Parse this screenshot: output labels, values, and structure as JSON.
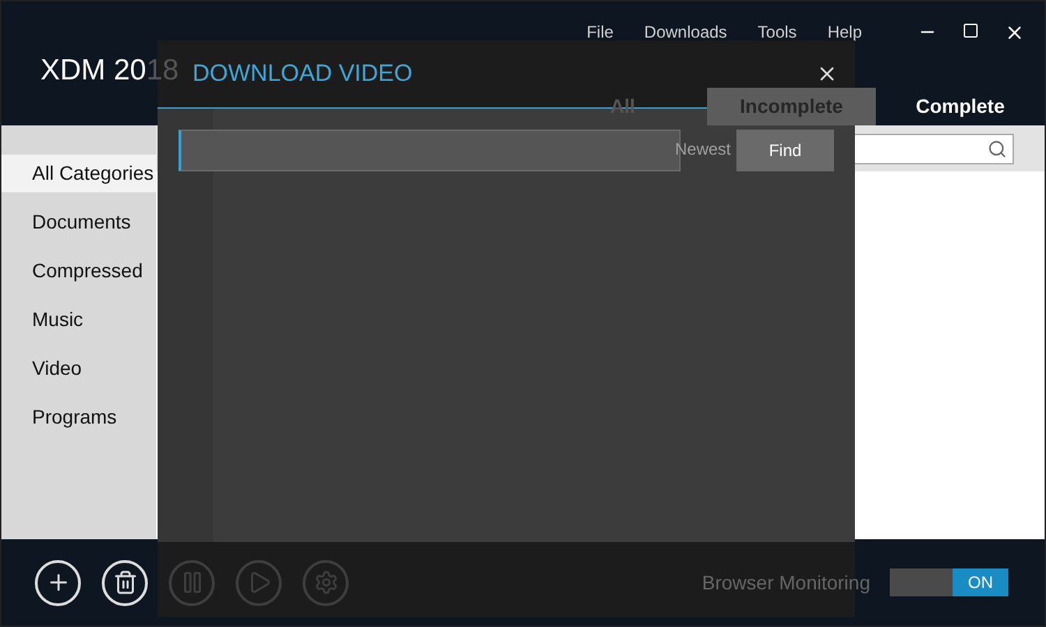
{
  "window": {
    "title": "XDM 2018",
    "menu": [
      "File",
      "Downloads",
      "Tools",
      "Help"
    ]
  },
  "tabs": [
    {
      "label": "All",
      "selected": false
    },
    {
      "label": "Incomplete",
      "selected": true
    },
    {
      "label": "Complete",
      "selected": false
    }
  ],
  "sort_label": "Newest",
  "categories": [
    {
      "label": "All Categories",
      "selected": true
    },
    {
      "label": "Documents",
      "selected": false
    },
    {
      "label": "Compressed",
      "selected": false
    },
    {
      "label": "Music",
      "selected": false
    },
    {
      "label": "Video",
      "selected": false
    },
    {
      "label": "Programs",
      "selected": false
    }
  ],
  "toolbar": [
    {
      "kind": "add",
      "disabled": false
    },
    {
      "kind": "delete",
      "disabled": false
    },
    {
      "kind": "pause",
      "disabled": true
    },
    {
      "kind": "resume",
      "disabled": true
    },
    {
      "kind": "settings",
      "disabled": true
    }
  ],
  "browser_monitoring": {
    "label": "Browser Monitoring",
    "on": true,
    "state_label": "ON"
  },
  "dialog": {
    "title": "DOWNLOAD VIDEO",
    "button": "Find"
  }
}
